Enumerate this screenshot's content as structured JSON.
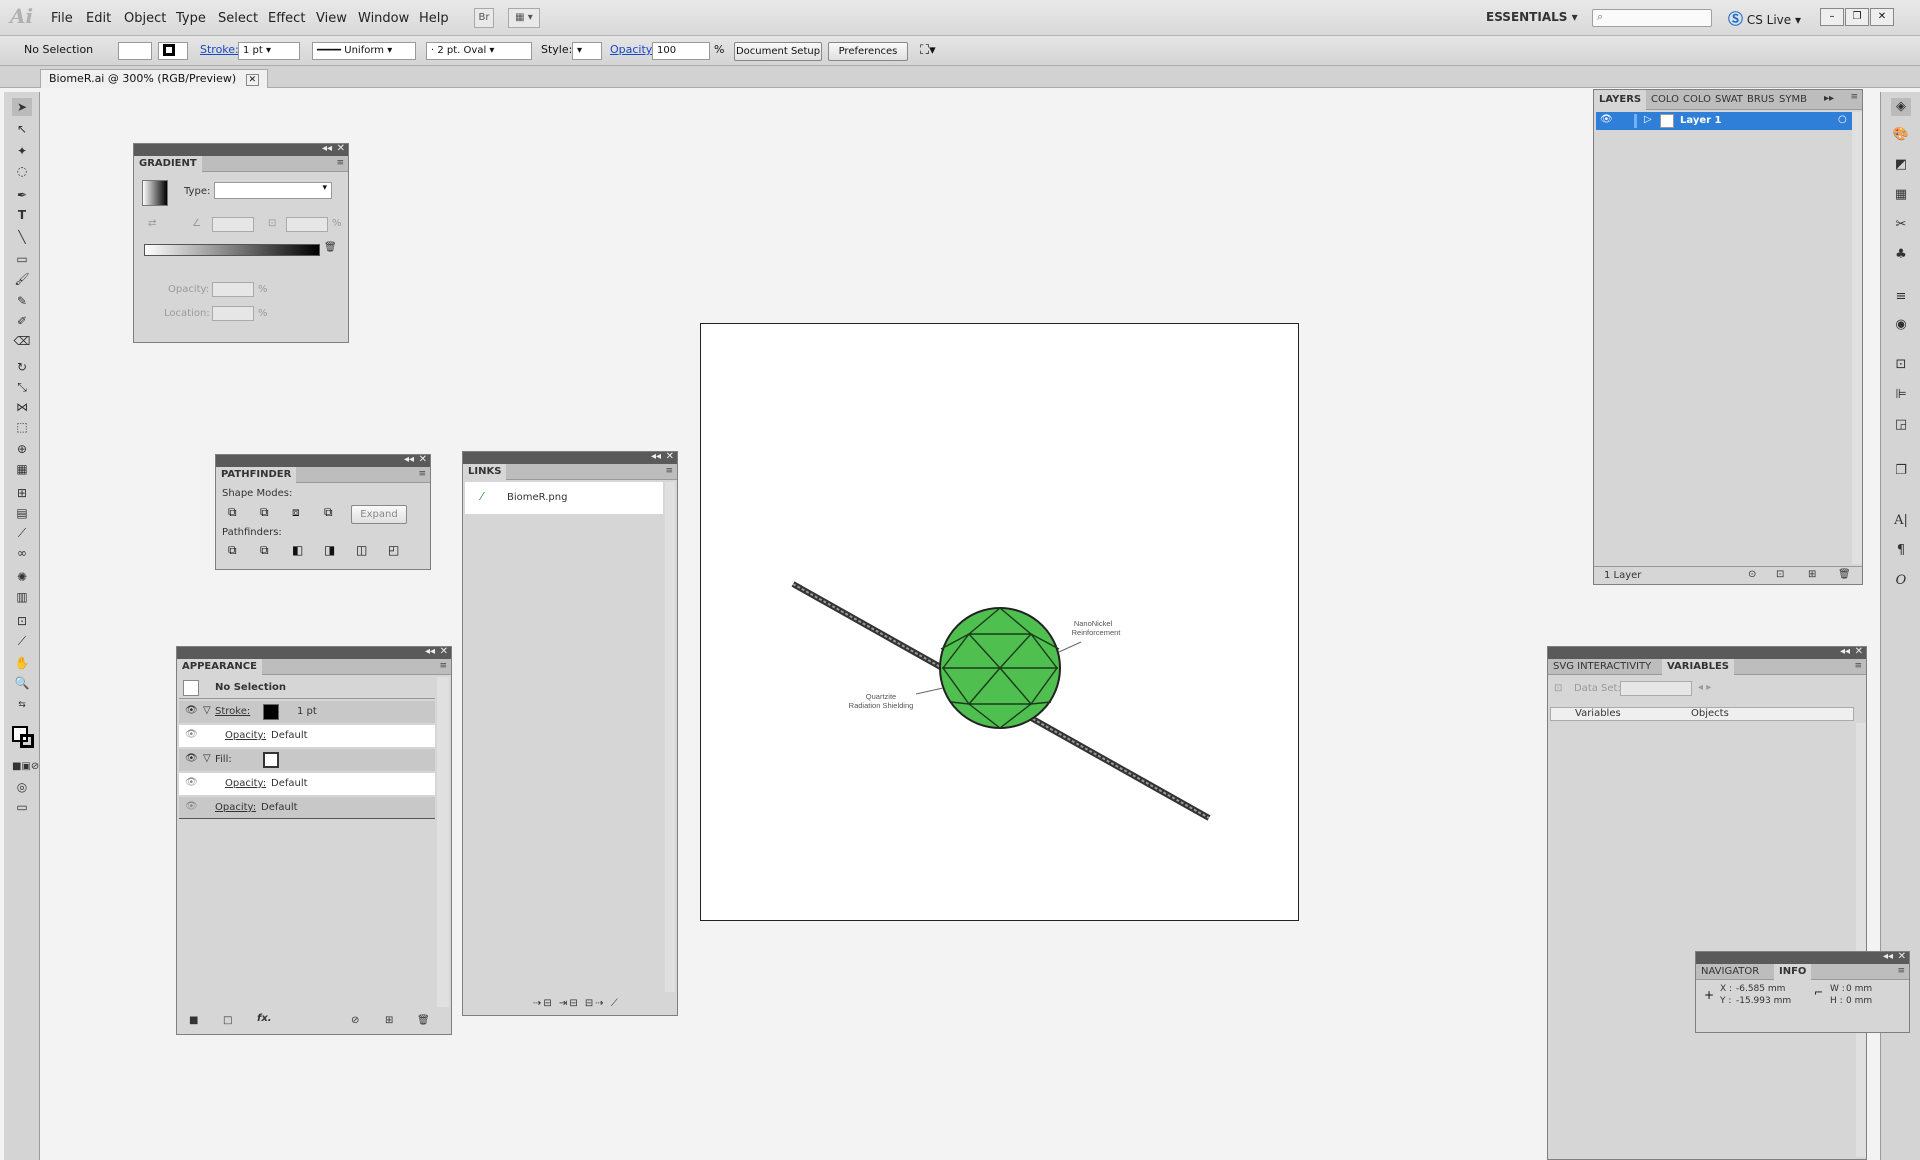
{
  "app": {
    "logo": "Ai",
    "menu": [
      "File",
      "Edit",
      "Object",
      "Type",
      "Select",
      "Effect",
      "View",
      "Window",
      "Help"
    ],
    "bridge_label": "Br",
    "workspace": "ESSENTIALS",
    "cs_live": "CS Live"
  },
  "controlbar": {
    "selection": "No Selection",
    "stroke_label": "Stroke:",
    "stroke_value": "1 pt",
    "profile": "Uniform",
    "brush": "2 pt. Oval",
    "style_label": "Style:",
    "opacity_label": "Opacity:",
    "opacity_value": "100",
    "percent": "%",
    "doc_setup": "Document Setup",
    "preferences": "Preferences"
  },
  "document": {
    "tab_title": "BiomeR.ai @ 300% (RGB/Preview)"
  },
  "gradient": {
    "title": "GRADIENT",
    "type_label": "Type:",
    "opacity_label": "Opacity:",
    "location_label": "Location:",
    "pct": "%"
  },
  "pathfinder": {
    "title": "PATHFINDER",
    "shape_modes": "Shape Modes:",
    "expand": "Expand",
    "pathfinders": "Pathfinders:"
  },
  "links": {
    "title": "LINKS",
    "items": [
      "BiomeR.png"
    ]
  },
  "appearance": {
    "title": "APPEARANCE",
    "header": "No Selection",
    "stroke_label": "Stroke:",
    "stroke_value": "1 pt",
    "opacity_label": "Opacity:",
    "opacity_default": "Default",
    "fill_label": "Fill:",
    "fx": "fx."
  },
  "layers": {
    "tabs": [
      "LAYERS",
      "COLO",
      "COLO",
      "SWAT",
      "BRUS",
      "SYMB"
    ],
    "layer_name": "Layer 1",
    "count": "1 Layer"
  },
  "variables": {
    "tabs": [
      "SVG INTERACTIVITY",
      "VARIABLES"
    ],
    "data_set": "Data Set:",
    "col_variables": "Variables",
    "col_objects": "Objects"
  },
  "navigator": {
    "tabs": [
      "NAVIGATOR",
      "INFO"
    ],
    "x_label": "X :",
    "x_value": "-6.585 mm",
    "y_label": "Y :",
    "y_value": "-15.993 mm",
    "w_label": "W :",
    "w_value": "0 mm",
    "h_label": "H :",
    "h_value": "0 mm"
  },
  "artwork": {
    "label_top_1": "NanoNickel",
    "label_top_2": "Reinforcement",
    "label_left_1": "Quartzite",
    "label_left_2": "Radiation Shielding",
    "sphere_color": "#4fbf4f"
  }
}
